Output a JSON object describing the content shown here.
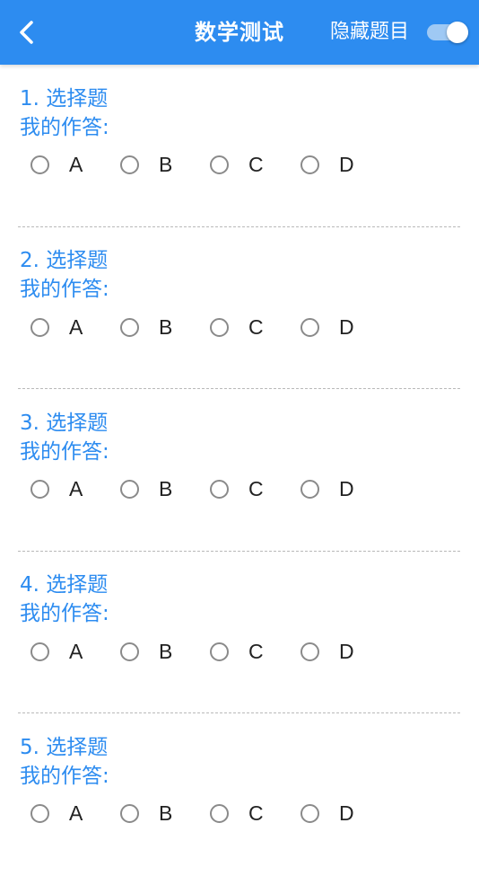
{
  "header": {
    "title": "数学测试",
    "hide_label": "隐藏题目",
    "toggle_on": true,
    "accent_color": "#2d8cf0"
  },
  "answer_label": "我的作答:",
  "questions": [
    {
      "title": "1. 选择题",
      "options": [
        "A",
        "B",
        "C",
        "D"
      ]
    },
    {
      "title": "2. 选择题",
      "options": [
        "A",
        "B",
        "C",
        "D"
      ]
    },
    {
      "title": "3. 选择题",
      "options": [
        "A",
        "B",
        "C",
        "D"
      ]
    },
    {
      "title": "4. 选择题",
      "options": [
        "A",
        "B",
        "C",
        "D"
      ]
    },
    {
      "title": "5. 选择题",
      "options": [
        "A",
        "B",
        "C",
        "D"
      ]
    }
  ]
}
